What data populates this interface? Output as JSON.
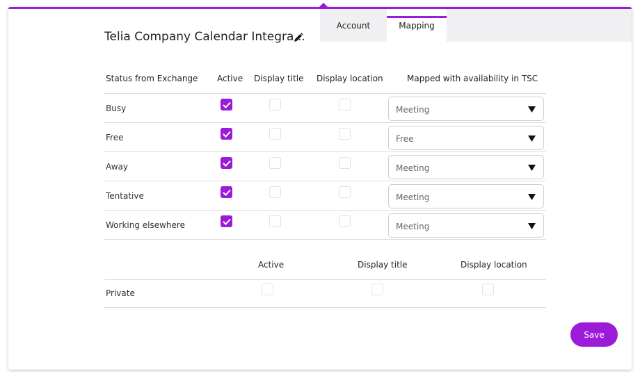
{
  "tabs": [
    {
      "label": "Account",
      "active": false
    },
    {
      "label": "Mapping",
      "active": true
    }
  ],
  "title": "Telia Company Calendar Integra...",
  "mapping_table": {
    "headers": {
      "status": "Status from Exchange",
      "active": "Active",
      "display_title": "Display title",
      "display_location": "Display location",
      "mapped": "Mapped with availability in TSC"
    },
    "rows": [
      {
        "status": "Busy",
        "active": true,
        "display_title": false,
        "display_location": false,
        "mapped": "Meeting"
      },
      {
        "status": "Free",
        "active": true,
        "display_title": false,
        "display_location": false,
        "mapped": "Free"
      },
      {
        "status": "Away",
        "active": true,
        "display_title": false,
        "display_location": false,
        "mapped": "Meeting"
      },
      {
        "status": "Tentative",
        "active": true,
        "display_title": false,
        "display_location": false,
        "mapped": "Meeting"
      },
      {
        "status": "Working elsewhere",
        "active": true,
        "display_title": false,
        "display_location": false,
        "mapped": "Meeting"
      }
    ]
  },
  "private_table": {
    "headers": {
      "active": "Active",
      "display_title": "Display title",
      "display_location": "Display location"
    },
    "row": {
      "label": "Private",
      "active": false,
      "display_title": false,
      "display_location": false
    }
  },
  "save_label": "Save",
  "colors": {
    "accent": "#9b1bd8"
  },
  "icons": {
    "edit": "pencil-icon",
    "dropdown": "caret-down-icon",
    "check": "check-icon"
  }
}
